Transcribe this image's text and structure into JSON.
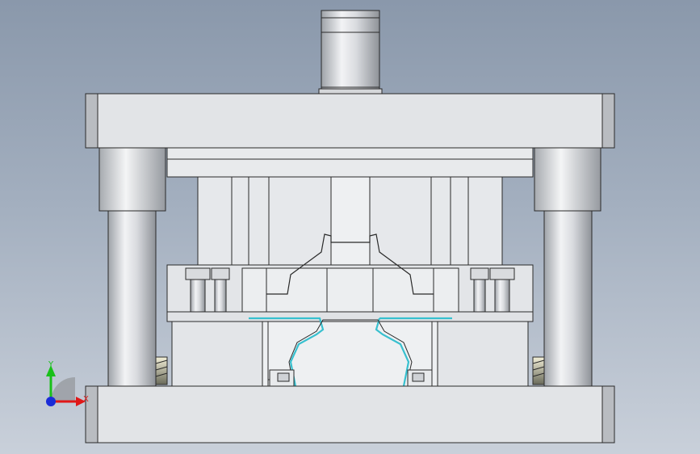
{
  "viewport": {
    "background_top": "#8a98ab",
    "background_bottom": "#c9d0da"
  },
  "triad": {
    "y_label": "Y",
    "x_label": "X",
    "y_color": "#19c019",
    "x_color": "#e01818",
    "z_color": "#1a2cd8"
  },
  "colors": {
    "metal": "#e4e6e9",
    "metal_dark": "#b9bcc1",
    "edge": "#2a2a2a",
    "part_strip": "#37c0cf"
  },
  "parts": {
    "top_plate": "top-die-plate",
    "bottom_plate": "bottom-die-plate",
    "shank": "die-shank",
    "guide_posts": [
      "left-guide-post",
      "right-guide-post"
    ],
    "springs": [
      "left-spring",
      "right-spring"
    ]
  }
}
